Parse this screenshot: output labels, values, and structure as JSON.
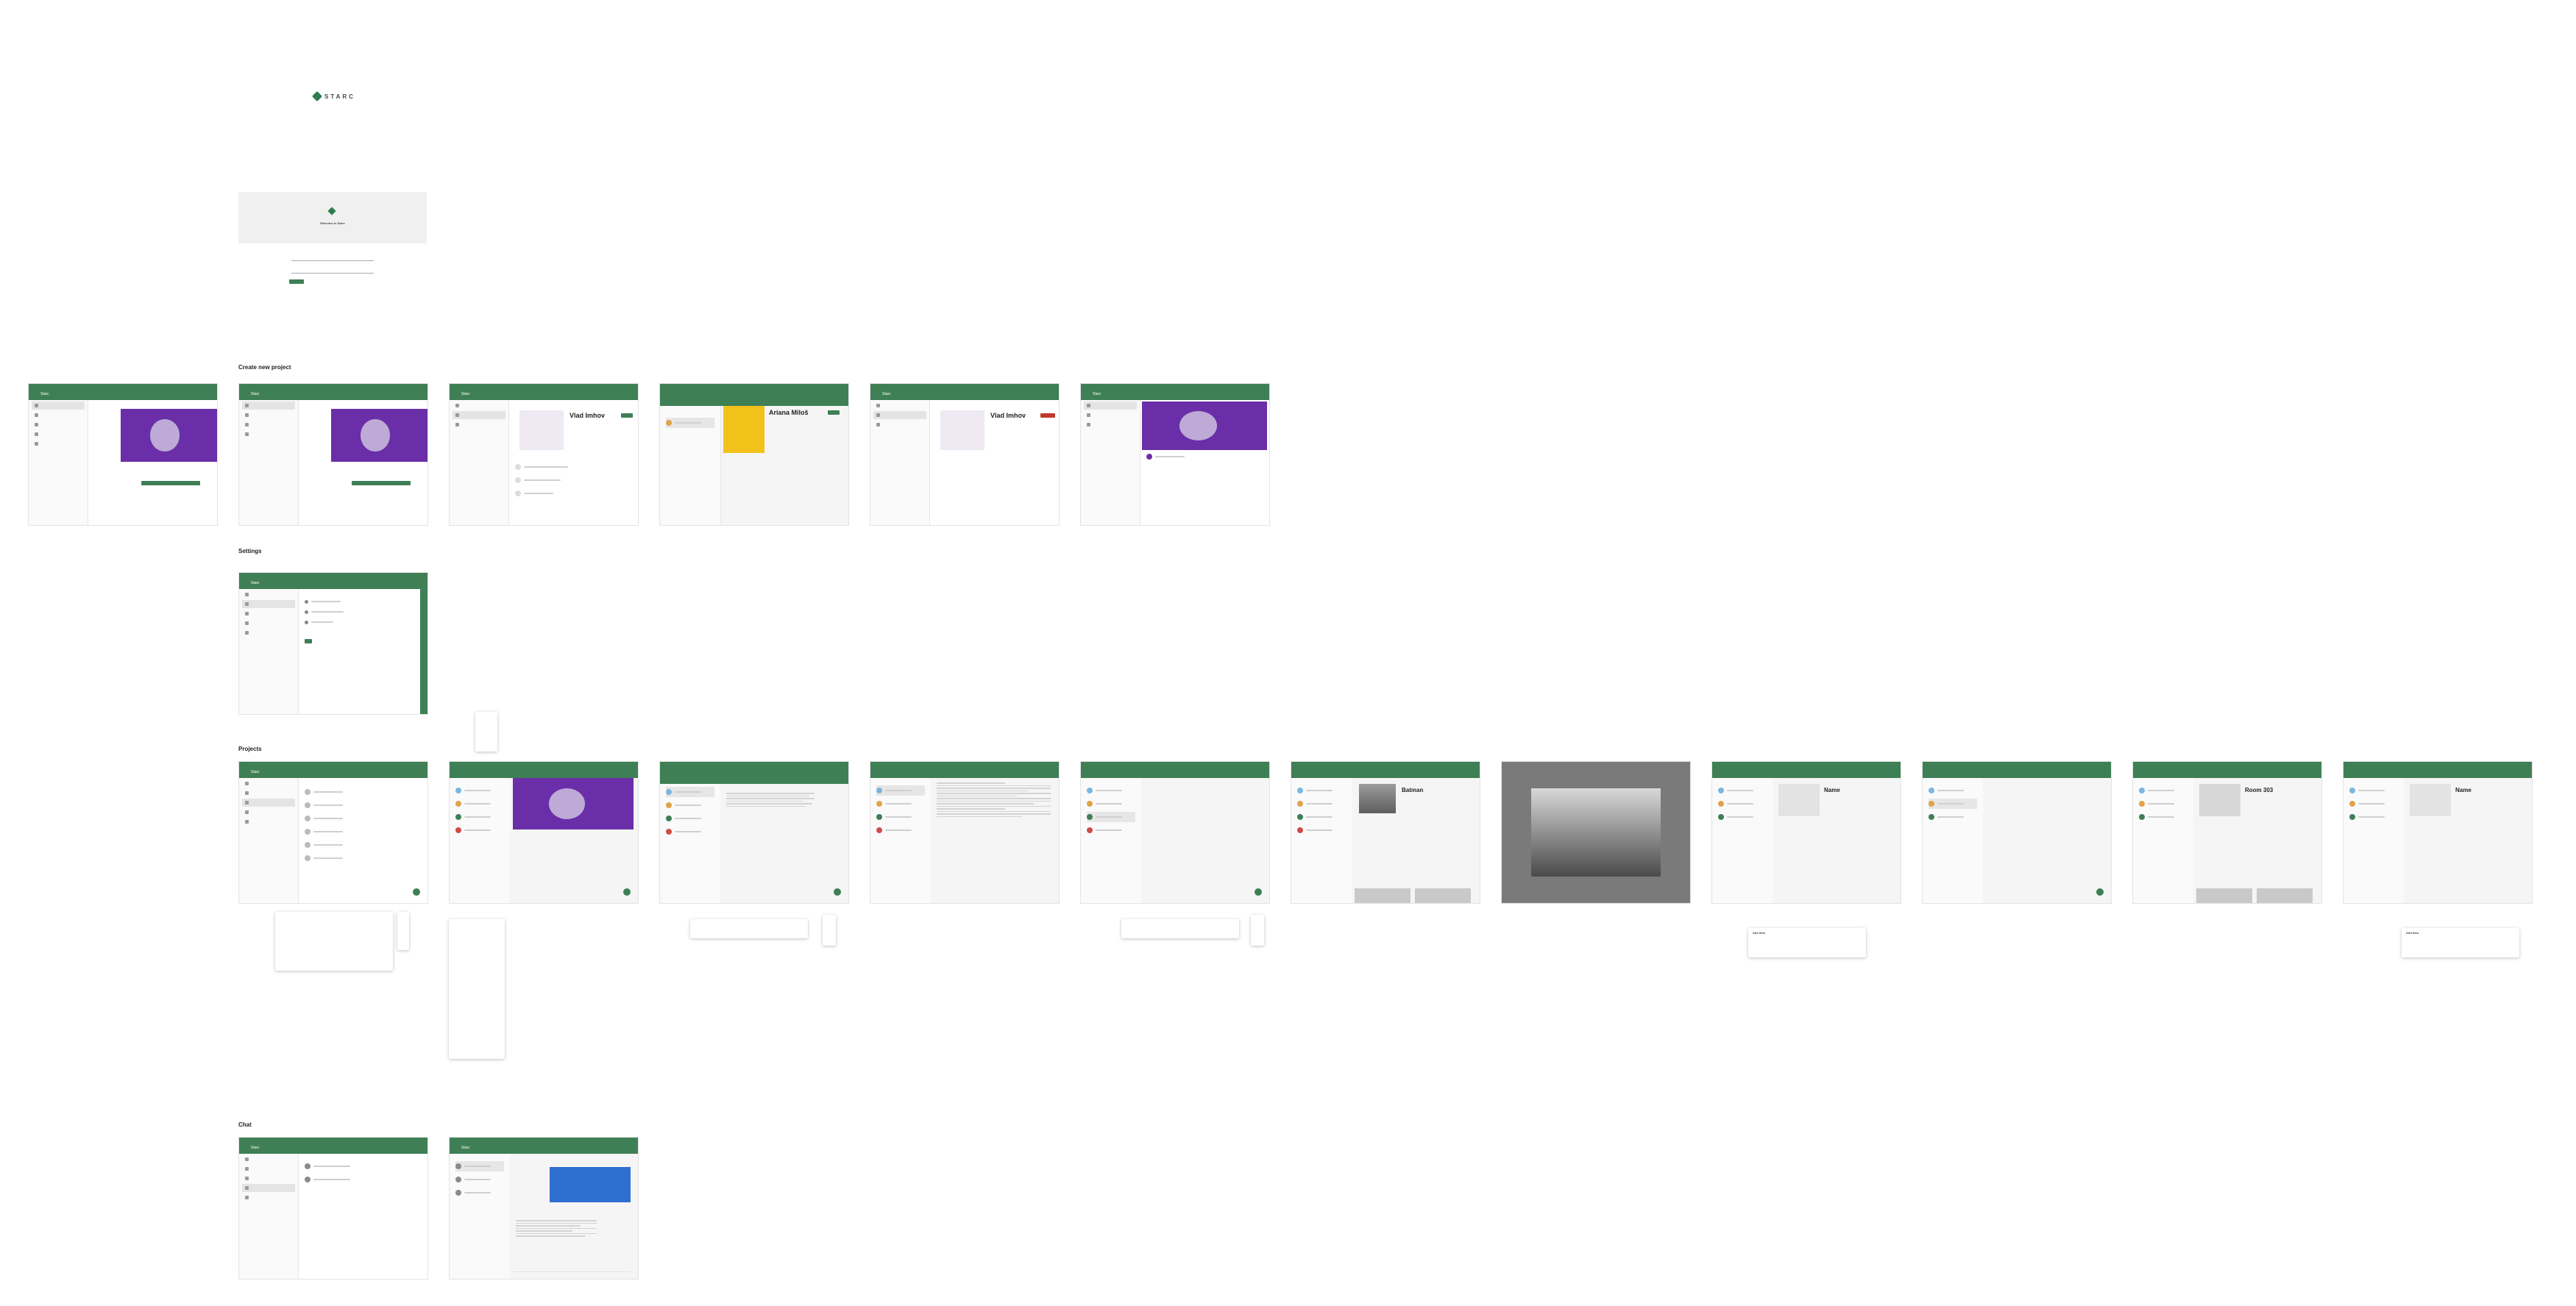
{
  "brand": {
    "logo_text": "STARC",
    "app_name": "Starc"
  },
  "login": {
    "title": "Welcome to Starc"
  },
  "sections": {
    "create_project": "Create new project",
    "settings": "Settings",
    "projects": "Projects",
    "chat": "Chat"
  },
  "profiles": {
    "vlad_name": "Vlad Imhov",
    "ariana_name": "Ariana Miloš",
    "batman_name": "Batman",
    "name_label": "Name",
    "room_name": "Room 303"
  },
  "dialogs": {
    "add_item": "Add item"
  },
  "colors": {
    "brand_green": "#3f7f55",
    "hero_purple": "#6a2fa8"
  }
}
